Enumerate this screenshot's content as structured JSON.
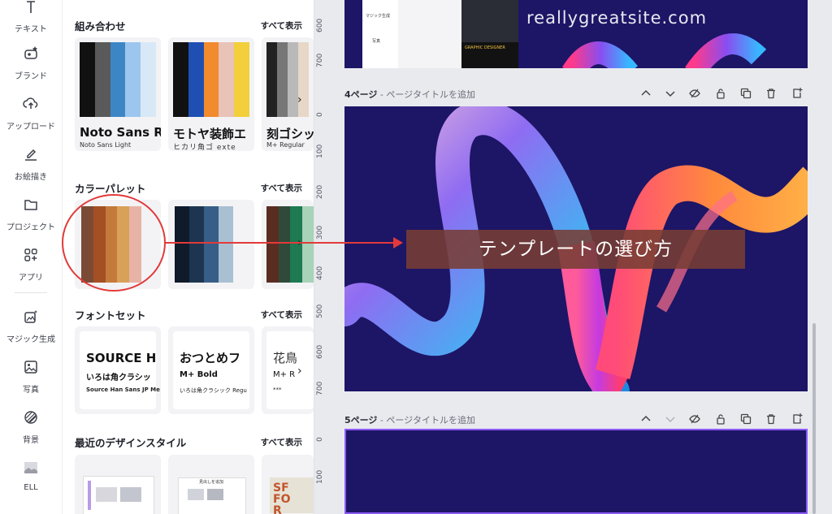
{
  "rail": {
    "items": [
      {
        "label": "テキスト",
        "icon": "text-icon"
      },
      {
        "label": "ブランド",
        "icon": "brand-icon"
      },
      {
        "label": "アップロード",
        "icon": "upload-icon"
      },
      {
        "label": "お絵描き",
        "icon": "draw-icon"
      },
      {
        "label": "プロジェクト",
        "icon": "folder-icon"
      },
      {
        "label": "アプリ",
        "icon": "apps-icon"
      },
      {
        "label": "マジック生成",
        "icon": "magic-icon"
      },
      {
        "label": "写真",
        "icon": "photo-icon"
      },
      {
        "label": "背景",
        "icon": "background-icon"
      },
      {
        "label": "ELL",
        "icon": "ell-icon"
      }
    ]
  },
  "panel": {
    "combos": {
      "title": "組み合わせ",
      "see_all": "すべて表示",
      "cards": [
        {
          "font_big": "Noto Sans Re",
          "font_small": "Noto Sans Light",
          "colors": [
            "#111111",
            "#5a5a5a",
            "#3d86c6",
            "#9cc6ee",
            "#d9e8f7"
          ]
        },
        {
          "font_big": "モトヤ装飾エ",
          "font_small": "ヒカリ角ゴ exte",
          "colors": [
            "#111111",
            "#1f4fb3",
            "#f28a2e",
            "#e9c2b8",
            "#f2cf3b"
          ]
        },
        {
          "font_big": "刻ゴシッ",
          "font_small": "M+ Regular",
          "colors": [
            "#222222",
            "#777777",
            "#b9b9b9",
            "#e7d7c7"
          ]
        }
      ]
    },
    "palettes": {
      "title": "カラーパレット",
      "see_all": "すべて表示",
      "cards": [
        {
          "colors": [
            "#7b4a34",
            "#a44f24",
            "#c47a3a",
            "#d9a05a",
            "#e7b3a5"
          ]
        },
        {
          "colors": [
            "#0f1a2b",
            "#1d3550",
            "#375e86",
            "#a9c0d3",
            "#f3f3f6"
          ]
        },
        {
          "colors": [
            "#5a2d22",
            "#2f4a3a",
            "#1d7a53",
            "#a7d3b8"
          ]
        }
      ]
    },
    "fontsets": {
      "title": "フォントセット",
      "see_all": "すべて表示",
      "cards": [
        {
          "big": "SOURCE H",
          "mid": "いろは角クラシッ",
          "small": "Source Han Sans JP Me"
        },
        {
          "big": "おつとめフ",
          "mid": "M+ Bold",
          "small": "いろは角クラシック Regu"
        },
        {
          "big": "花鳥",
          "mid": "M+ R",
          "small": "***"
        }
      ]
    },
    "recent": {
      "title": "最近のデザインスタイル",
      "see_all": "すべて表示",
      "card2_label": "見出しを追加",
      "card3_label": "SF FOR"
    }
  },
  "canvas": {
    "ruler_ticks_top": [
      "600",
      "700"
    ],
    "ruler_ticks_mid": [
      "0",
      "100",
      "200",
      "300",
      "400",
      "500",
      "600",
      "700"
    ],
    "ruler_ticks_bottom": [
      "0",
      "100"
    ],
    "page3_watermark": "reallygreatsite.com",
    "page3_labels": [
      "マジック生成",
      "写真"
    ],
    "page3_card_title": "GRAPHIC DESIGNER",
    "page4": {
      "num": "4ページ",
      "hint": "ページタイトルを追加"
    },
    "page5": {
      "num": "5ページ",
      "hint": "ページタイトルを追加"
    },
    "banner": "テンプレートの選び方",
    "page_bg": "#1d1566",
    "accent_red": "#e23a3a"
  }
}
